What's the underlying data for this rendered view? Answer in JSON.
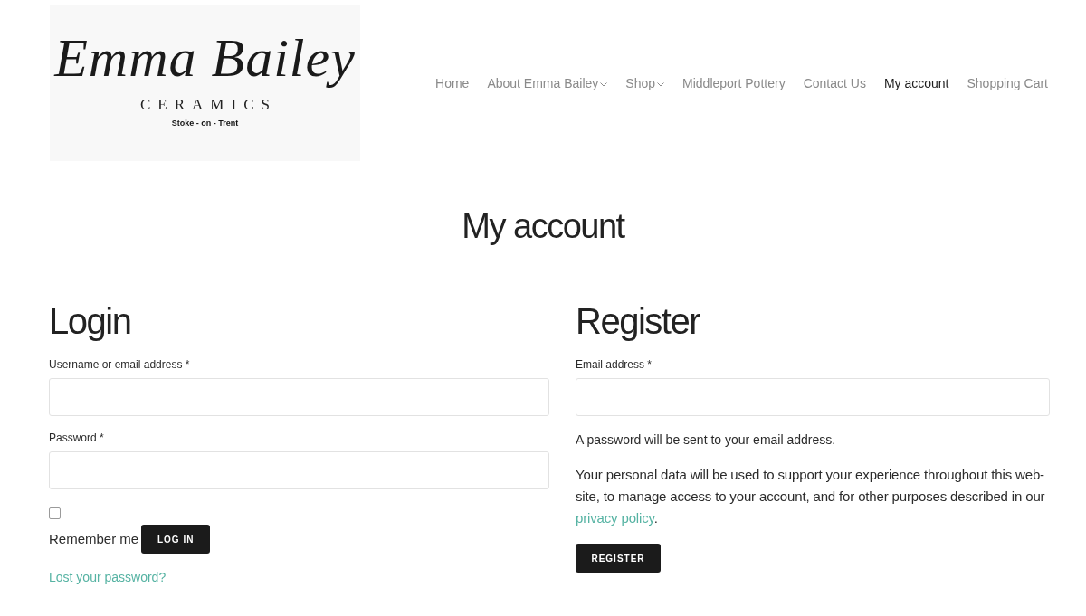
{
  "logo": {
    "name": "Emma Bailey",
    "tagline": "CERAMICS",
    "place": "Stoke - on - Trent"
  },
  "nav": [
    {
      "label": "Home",
      "selected": false,
      "has_submenu": false
    },
    {
      "label": "About Emma Bailey",
      "selected": false,
      "has_submenu": true
    },
    {
      "label": "Shop",
      "selected": false,
      "has_submenu": true
    },
    {
      "label": "Middleport Pottery",
      "selected": false,
      "has_submenu": false
    },
    {
      "label": "Contact Us",
      "selected": false,
      "has_submenu": false
    },
    {
      "label": "My account",
      "selected": true,
      "has_submenu": false
    },
    {
      "label": "Shopping Cart",
      "selected": false,
      "has_submenu": false
    }
  ],
  "page_title": "My account",
  "login": {
    "heading": "Login",
    "fields": [
      {
        "label": "Username or email address *"
      },
      {
        "label": "Password *"
      }
    ],
    "remember": {
      "label": "Remember me",
      "checked": false
    },
    "button": "LOG IN",
    "lost_link": "Lost your password?"
  },
  "register": {
    "heading": "Register",
    "fields": [
      {
        "label": "Email address *"
      }
    ],
    "note": "A password will be sent to your email address.",
    "privacy_text": "Your personal data will be used to support your experience throughout this web-site, to manage access to your account, and for other purposes described in our",
    "privacy_link": "privacy policy",
    "privacy_end": ".",
    "button": "REGISTER"
  }
}
